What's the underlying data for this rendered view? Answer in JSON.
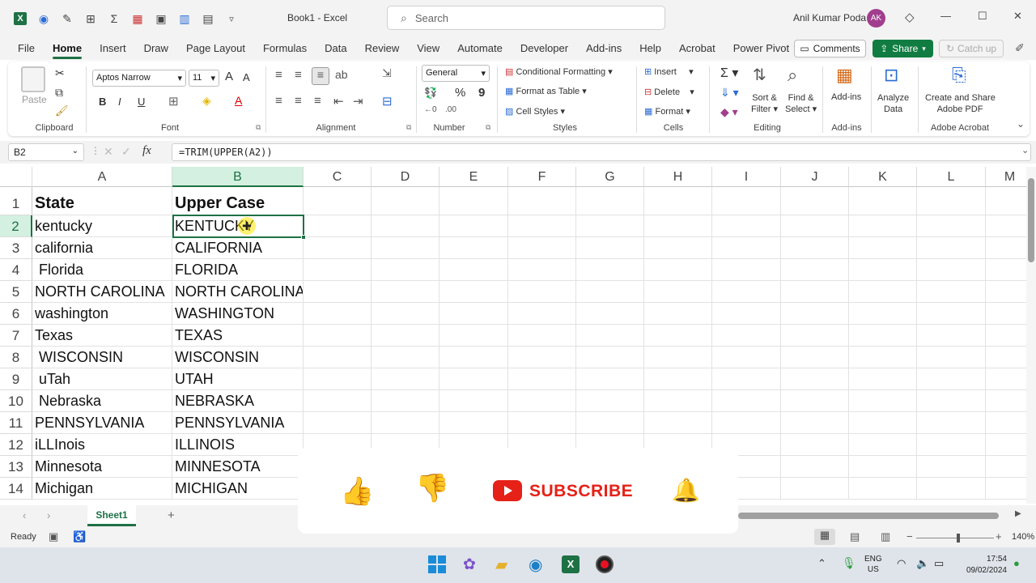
{
  "window": {
    "title": "Book1 - Excel",
    "search_placeholder": "Search",
    "user": "Anil Kumar Poda",
    "initials": "AK",
    "min": "—",
    "max": "☐",
    "close": "✕"
  },
  "menu": [
    "File",
    "Home",
    "Insert",
    "Draw",
    "Page Layout",
    "Formulas",
    "Data",
    "Review",
    "View",
    "Automate",
    "Developer",
    "Add-ins",
    "Help",
    "Acrobat",
    "Power Pivot"
  ],
  "buttons": {
    "comments": "Comments",
    "share": "Share",
    "catchup": "Catch up"
  },
  "ribbon": {
    "paste": "Paste",
    "clipboard": "Clipboard",
    "font_name": "Aptos Narrow",
    "font_size": "11",
    "font": "Font",
    "bold": "B",
    "italic": "I",
    "underline": "U",
    "grow": "A",
    "shrink": "A",
    "alignment": "Alignment",
    "number_format": "General",
    "percent": "%",
    "comma": "9",
    "number": "Number",
    "cond_fmt": "Conditional Formatting",
    "fmt_table": "Format as Table",
    "cell_styles": "Cell Styles",
    "styles": "Styles",
    "insert": "Insert",
    "delete": "Delete",
    "format": "Format",
    "cells": "Cells",
    "sort_filter_1": "Sort &",
    "sort_filter_2": "Filter",
    "find_select_1": "Find &",
    "find_select_2": "Select",
    "editing": "Editing",
    "addins_btn": "Add-ins",
    "addins": "Add-ins",
    "analyze_1": "Analyze",
    "analyze_2": "Data",
    "create_pdf_1": "Create and Share",
    "create_pdf_2": "Adobe PDF",
    "adobe": "Adobe Acrobat"
  },
  "formula": {
    "name_box": "B2",
    "fx": "fx",
    "formula": "=TRIM(UPPER(A2))"
  },
  "columns": [
    "A",
    "B",
    "C",
    "D",
    "E",
    "F",
    "G",
    "H",
    "I",
    "J",
    "K",
    "L",
    "M"
  ],
  "rows": [
    {
      "n": "1",
      "a": "State",
      "b": "Upper Case"
    },
    {
      "n": "2",
      "a": "kentucky",
      "b": "KENTUCKY"
    },
    {
      "n": "3",
      "a": "california",
      "b": "CALIFORNIA"
    },
    {
      "n": "4",
      "a": " Florida",
      "b": "FLORIDA"
    },
    {
      "n": "5",
      "a": "NORTH CAROLINA",
      "b": "NORTH CAROLINA"
    },
    {
      "n": "6",
      "a": "washington",
      "b": "WASHINGTON"
    },
    {
      "n": "7",
      "a": "Texas",
      "b": "TEXAS"
    },
    {
      "n": "8",
      "a": " WISCONSIN",
      "b": "WISCONSIN"
    },
    {
      "n": "9",
      "a": " uTah",
      "b": "UTAH"
    },
    {
      "n": "10",
      "a": " Nebraska",
      "b": "NEBRASKA"
    },
    {
      "n": "11",
      "a": "PENNSYLVANIA",
      "b": "PENNSYLVANIA"
    },
    {
      "n": "12",
      "a": "iLLInois",
      "b": "ILLINOIS"
    },
    {
      "n": "13",
      "a": "Minnesota",
      "b": "MINNESOTA"
    },
    {
      "n": "14",
      "a": "Michigan",
      "b": "MICHIGAN"
    }
  ],
  "sheet": {
    "tab": "Sheet1",
    "add": "+"
  },
  "status": {
    "ready": "Ready",
    "zoom": "140%",
    "minus": "−",
    "plus": "+"
  },
  "overlay": {
    "subscribe": "SUBSCRIBE"
  },
  "taskbar": {
    "lang1": "ENG",
    "lang2": "US",
    "time": "17:54",
    "date": "09/02/2024"
  },
  "colors": {
    "excel_green": "#1e7145",
    "share_green": "#107c41",
    "youtube_red": "#e62117"
  }
}
